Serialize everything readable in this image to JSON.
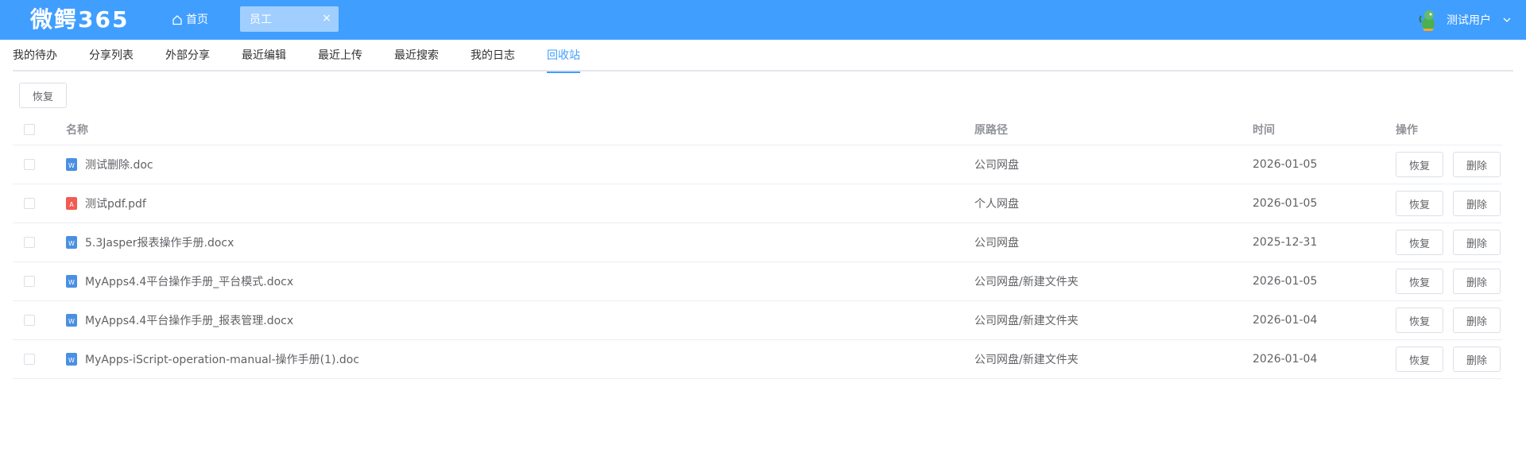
{
  "header": {
    "logo": "微鳄365",
    "home_label": "首页",
    "open_tab_label": "员工",
    "close_glyph": "×",
    "user_name": "测试用户",
    "accent_color": "#409eff"
  },
  "subnav": {
    "items": [
      {
        "label": "我的待办"
      },
      {
        "label": "分享列表"
      },
      {
        "label": "外部分享"
      },
      {
        "label": "最近编辑"
      },
      {
        "label": "最近上传"
      },
      {
        "label": "最近搜索"
      },
      {
        "label": "我的日志"
      },
      {
        "label": "回收站"
      }
    ],
    "active": "回收站"
  },
  "toolbar": {
    "restore_label": "恢复"
  },
  "table": {
    "columns": {
      "name": "名称",
      "path": "原路径",
      "time": "时间",
      "ops": "操作"
    },
    "restore_label": "恢复",
    "delete_label": "删除",
    "rows": [
      {
        "name": "测试删除.doc",
        "type": "word",
        "icon": "word-file-icon",
        "path": "公司网盘",
        "time": "2026-01-05"
      },
      {
        "name": "测试pdf.pdf",
        "type": "pdf",
        "icon": "pdf-file-icon",
        "path": "个人网盘",
        "time": "2026-01-05"
      },
      {
        "name": "5.3Jasper报表操作手册.docx",
        "type": "word",
        "icon": "word-file-icon",
        "path": "公司网盘",
        "time": "2025-12-31"
      },
      {
        "name": "MyApps4.4平台操作手册_平台模式.docx",
        "type": "word",
        "icon": "word-file-icon",
        "path": "公司网盘/新建文件夹",
        "time": "2026-01-05"
      },
      {
        "name": "MyApps4.4平台操作手册_报表管理.docx",
        "type": "word",
        "icon": "word-file-icon",
        "path": "公司网盘/新建文件夹",
        "time": "2026-01-04"
      },
      {
        "name": "MyApps-iScript-operation-manual-操作手册(1).doc",
        "type": "word",
        "icon": "word-file-icon",
        "path": "公司网盘/新建文件夹",
        "time": "2026-01-04"
      }
    ]
  }
}
